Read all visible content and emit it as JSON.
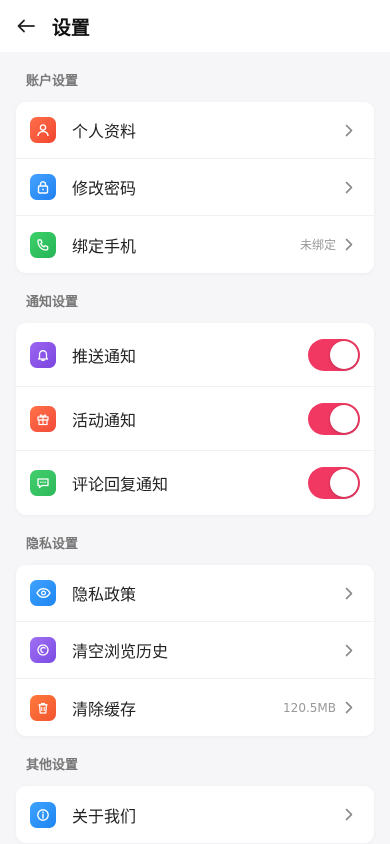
{
  "header": {
    "title": "设置"
  },
  "sections": [
    {
      "label": "账户设置",
      "items": [
        {
          "label": "个人资料",
          "icon": "user-icon",
          "color": "#f45a3a"
        },
        {
          "label": "修改密码",
          "icon": "lock-icon",
          "color": "#2a8ef5"
        },
        {
          "label": "绑定手机",
          "icon": "phone-icon",
          "color": "#2fc25e",
          "value": "未绑定"
        }
      ]
    },
    {
      "label": "通知设置",
      "items": [
        {
          "label": "推送通知",
          "icon": "bell-icon",
          "color": "#8654e8",
          "toggle": true
        },
        {
          "label": "活动通知",
          "icon": "gift-icon",
          "color": "#f45a3a",
          "toggle": true
        },
        {
          "label": "评论回复通知",
          "icon": "comment-icon",
          "color": "#34c45f",
          "toggle": true
        }
      ]
    },
    {
      "label": "隐私设置",
      "items": [
        {
          "label": "隐私政策",
          "icon": "eye-icon",
          "color": "#2a8ef5"
        },
        {
          "label": "清空浏览历史",
          "icon": "history-icon",
          "color": "#8654e8"
        },
        {
          "label": "清除缓存",
          "icon": "trash-icon",
          "color": "#f45a3a",
          "value": "120.5MB"
        }
      ]
    },
    {
      "label": "其他设置",
      "items": [
        {
          "label": "关于我们",
          "icon": "info-icon",
          "color": "#2a8ef5"
        }
      ]
    }
  ],
  "toggle_color": "#f03862"
}
